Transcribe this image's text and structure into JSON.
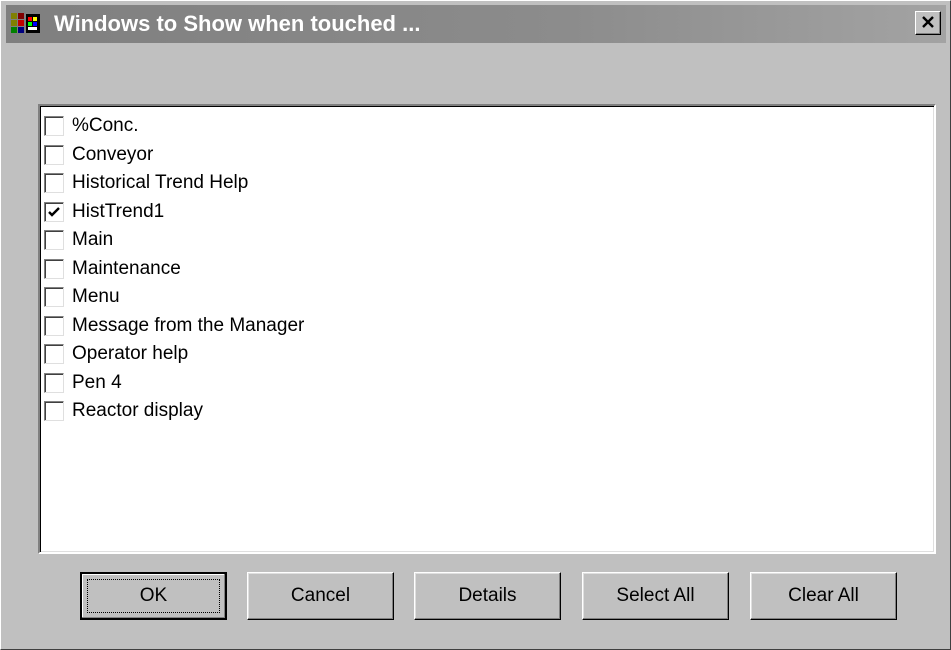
{
  "window": {
    "title": "Windows to Show when touched ...",
    "app_icon": "app-window-icon",
    "close_icon": "close-icon"
  },
  "list": {
    "items": [
      {
        "label": "%Conc.",
        "checked": false
      },
      {
        "label": "Conveyor",
        "checked": false
      },
      {
        "label": "Historical Trend Help",
        "checked": false
      },
      {
        "label": "HistTrend1",
        "checked": true
      },
      {
        "label": "Main",
        "checked": false
      },
      {
        "label": "Maintenance",
        "checked": false
      },
      {
        "label": "Menu",
        "checked": false
      },
      {
        "label": "Message from the Manager",
        "checked": false
      },
      {
        "label": "Operator help",
        "checked": false
      },
      {
        "label": "Pen 4",
        "checked": false
      },
      {
        "label": "Reactor display",
        "checked": false
      }
    ]
  },
  "buttons": {
    "ok": "OK",
    "cancel": "Cancel",
    "details": "Details",
    "select_all": "Select All",
    "clear_all": "Clear All"
  },
  "colors": {
    "face": "#c0c0c0",
    "titlebar_inactive": "#808080",
    "title_text": "#ffffff",
    "list_bg": "#ffffff"
  }
}
